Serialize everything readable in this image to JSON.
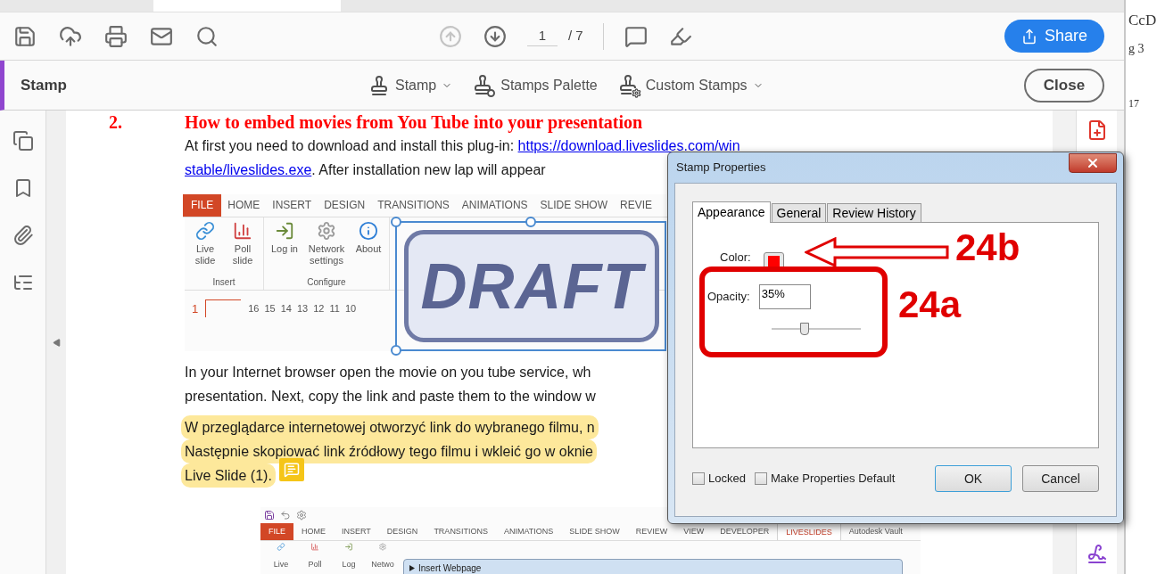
{
  "toolbar": {
    "previous_page": {
      "disabled": true
    },
    "next_page": {
      "disabled": false
    },
    "page_number": "1",
    "page_total": "/ 7",
    "share_button": "Share"
  },
  "stamp_bar": {
    "title": "Stamp",
    "menus": [
      {
        "label": "Stamp",
        "dropdown": true,
        "kind": "stamp"
      },
      {
        "label": "Stamps Palette",
        "dropdown": false,
        "kind": "palette"
      },
      {
        "label": "Custom Stamps",
        "dropdown": true,
        "kind": "custom"
      }
    ],
    "close_button": "Close"
  },
  "document": {
    "heading": {
      "number": "2.",
      "text": "How to embed movies from You Tube into your presentation"
    },
    "paragraph_1": [
      [
        {
          "text": "At first you need to download and install this plug-in: ",
          "link": false
        },
        {
          "text": "https://download.liveslides.com/win",
          "link": true
        }
      ],
      [
        {
          "text": "stable/liveslides.exe",
          "link": true
        },
        {
          "text": ". After installation new lap will appear",
          "link": false
        }
      ]
    ],
    "screenshot_1": {
      "tabs": [
        {
          "label": "FILE",
          "kind": "file",
          "selected": false
        },
        {
          "label": "HOME",
          "kind": "tab",
          "selected": false
        },
        {
          "label": "INSERT",
          "kind": "tab",
          "selected": false
        },
        {
          "label": "DESIGN",
          "kind": "tab",
          "selected": false
        },
        {
          "label": "TRANSITIONS",
          "kind": "tab",
          "selected": false
        },
        {
          "label": "ANIMATIONS",
          "kind": "tab",
          "selected": false
        },
        {
          "label": "SLIDE SHOW",
          "kind": "tab",
          "selected": false
        },
        {
          "label": "REVIE",
          "kind": "tab",
          "selected": false
        }
      ],
      "groups": [
        {
          "label": "Insert",
          "buttons": [
            {
              "label": "Live slide",
              "kind": "live"
            },
            {
              "label": "Poll slide",
              "kind": "poll"
            }
          ]
        },
        {
          "label": "Configure",
          "buttons": [
            {
              "label": "Log in",
              "kind": "login"
            },
            {
              "label": "Network settings",
              "kind": "settings"
            },
            {
              "label": "About",
              "kind": "info"
            }
          ]
        }
      ],
      "slide_number": "1",
      "ruler": [
        "16",
        "15",
        "14",
        "13",
        "12",
        "11",
        "10"
      ]
    },
    "stamp": {
      "text": "DRAFT",
      "selected": true
    },
    "paragraph_2": [
      "In your Internet browser open the movie on you tube service, wh",
      "presentation. Next, copy the link and paste them to the window w"
    ],
    "paragraph_3": [
      "W przeglądarce internetowej otworzyć link do wybranego filmu, n",
      "Następnie skopiować link źródłowy tego filmu i wkleić go w oknie",
      "Live Slide (1)."
    ],
    "screenshot_2": {
      "tabs": [
        {
          "label": "FILE",
          "kind": "file",
          "selected": false
        },
        {
          "label": "HOME",
          "kind": "tab",
          "selected": false
        },
        {
          "label": "INSERT",
          "kind": "tab",
          "selected": false
        },
        {
          "label": "DESIGN",
          "kind": "tab",
          "selected": false
        },
        {
          "label": "TRANSITIONS",
          "kind": "tab",
          "selected": false
        },
        {
          "label": "ANIMATIONS",
          "kind": "tab",
          "selected": false
        },
        {
          "label": "SLIDE SHOW",
          "kind": "tab",
          "selected": false
        },
        {
          "label": "REVIEW",
          "kind": "tab",
          "selected": false
        },
        {
          "label": "VIEW",
          "kind": "tab",
          "selected": false
        },
        {
          "label": "DEVELOPER",
          "kind": "tab",
          "selected": false
        },
        {
          "label": "LIVESLIDES",
          "kind": "tab",
          "selected": true
        },
        {
          "label": "Autodesk Vault",
          "kind": "tab",
          "selected": false
        }
      ],
      "buttons": [
        {
          "label": "Live",
          "kind": "live"
        },
        {
          "label": "Poll",
          "kind": "poll"
        },
        {
          "label": "Log",
          "kind": "login"
        },
        {
          "label": "Netwo",
          "kind": "settings"
        }
      ],
      "window_title": "Insert Webpage"
    }
  },
  "dialog": {
    "title": "Stamp Properties",
    "tabs": [
      {
        "label": "Appearance",
        "selected": true
      },
      {
        "label": "General",
        "selected": false
      },
      {
        "label": "Review History",
        "selected": false
      }
    ],
    "color_label": "Color:",
    "color": "#ff0000",
    "opacity_label": "Opacity:",
    "opacity_value": "35%",
    "opacity": {
      "level": 0.37
    },
    "checkboxes": [
      {
        "label": "Locked",
        "checked": false
      },
      {
        "label": "Make Properties Default",
        "checked": false
      }
    ],
    "buttons": [
      {
        "label": "OK",
        "default": true
      },
      {
        "label": "Cancel",
        "default": false
      }
    ]
  },
  "annotations": [
    {
      "kind": "arrow",
      "label": "24b"
    },
    {
      "kind": "box",
      "label": "24a"
    }
  ],
  "word_fragment": [
    "CcD",
    "g 3",
    "17"
  ]
}
